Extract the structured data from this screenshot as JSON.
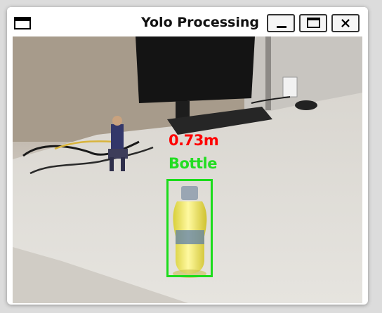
{
  "window": {
    "title": "Yolo Processing",
    "controls": {
      "minimize_icon": "minimize-icon",
      "maximize_icon": "maximize-icon",
      "close_icon": "close-icon"
    }
  },
  "detection": {
    "distance": "0.73m",
    "label": "Bottle",
    "distance_color": "#ff0000",
    "box_color": "#1bdc1b"
  }
}
